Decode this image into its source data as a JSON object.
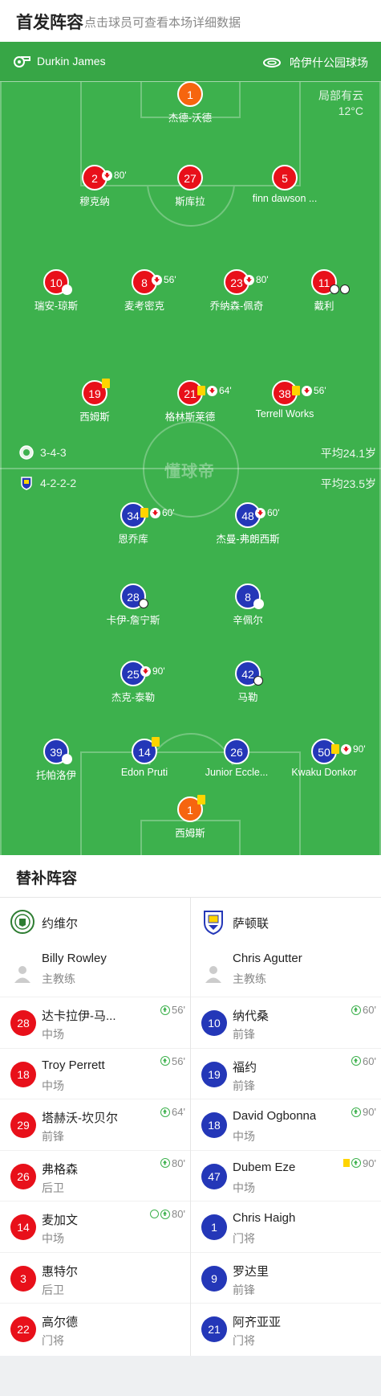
{
  "header": {
    "title": "首发阵容",
    "subtitle": "点击球员可查看本场详细数据"
  },
  "info": {
    "referee": "Durkin James",
    "venue": "哈伊什公园球场",
    "weather": "局部有云",
    "temperature": "12°C"
  },
  "home": {
    "formation": "3-4-3",
    "avg_age": "平均24.1岁",
    "players": [
      {
        "num": "1",
        "name": "杰德-沃德",
        "gk": true
      },
      {
        "num": "2",
        "name": "穆克纳",
        "sub_time": "80'"
      },
      {
        "num": "27",
        "name": "斯库拉"
      },
      {
        "num": "5",
        "name": "finn dawson ..."
      },
      {
        "num": "10",
        "name": "瑞安-琼斯"
      },
      {
        "num": "8",
        "name": "麦考密克",
        "sub_time": "56'"
      },
      {
        "num": "23",
        "name": "乔纳森-佩奇",
        "sub_time": "80'"
      },
      {
        "num": "11",
        "name": "戴利"
      },
      {
        "num": "19",
        "name": "西姆斯"
      },
      {
        "num": "21",
        "name": "格林斯莱德",
        "sub_time": "64'"
      },
      {
        "num": "38",
        "name": "Terrell Works",
        "sub_time": "56'"
      }
    ]
  },
  "away": {
    "formation": "4-2-2-2",
    "avg_age": "平均23.5岁",
    "players": [
      {
        "num": "34",
        "name": "恩乔库",
        "sub_time": "60'"
      },
      {
        "num": "48",
        "name": "杰曼-弗朗西斯",
        "sub_time": "60'"
      },
      {
        "num": "28",
        "name": "卡伊-詹宁斯"
      },
      {
        "num": "8",
        "name": "辛佩尔"
      },
      {
        "num": "25",
        "name": "杰克-泰勒",
        "sub_time": "90'"
      },
      {
        "num": "42",
        "name": "马勒"
      },
      {
        "num": "39",
        "name": "托帕洛伊"
      },
      {
        "num": "14",
        "name": "Edon Pruti"
      },
      {
        "num": "26",
        "name": "Junior Eccle..."
      },
      {
        "num": "50",
        "name": "Kwaku Donkor",
        "sub_time": "90'"
      },
      {
        "num": "1",
        "name": "西姆斯",
        "gk": true
      }
    ]
  },
  "watermark": "懂球帝",
  "subs": {
    "title": "替补阵容",
    "left": {
      "team": "约维尔",
      "coach": {
        "name": "Billy Rowley",
        "role": "主教练"
      },
      "players": [
        {
          "num": "28",
          "name": "达卡拉伊-马...",
          "pos": "中场",
          "time": "56'"
        },
        {
          "num": "18",
          "name": "Troy Perrett",
          "pos": "中场",
          "time": "56'"
        },
        {
          "num": "29",
          "name": "塔赫沃-坎贝尔",
          "pos": "前锋",
          "time": "64'"
        },
        {
          "num": "26",
          "name": "弗格森",
          "pos": "后卫",
          "time": "80'"
        },
        {
          "num": "14",
          "name": "麦加文",
          "pos": "中场",
          "time": "80'"
        },
        {
          "num": "3",
          "name": "惠特尔",
          "pos": "后卫",
          "time": ""
        },
        {
          "num": "22",
          "name": "高尔德",
          "pos": "门将",
          "time": ""
        }
      ]
    },
    "right": {
      "team": "萨顿联",
      "coach": {
        "name": "Chris Agutter",
        "role": "主教练"
      },
      "players": [
        {
          "num": "10",
          "name": "纳代桑",
          "pos": "前锋",
          "time": "60'"
        },
        {
          "num": "19",
          "name": "福约",
          "pos": "前锋",
          "time": "60'"
        },
        {
          "num": "18",
          "name": "David Ogbonna",
          "pos": "中场",
          "time": "90'"
        },
        {
          "num": "47",
          "name": "Dubem Eze",
          "pos": "中场",
          "time": "90'"
        },
        {
          "num": "1",
          "name": "Chris Haigh",
          "pos": "门将",
          "time": ""
        },
        {
          "num": "9",
          "name": "罗达里",
          "pos": "前锋",
          "time": ""
        },
        {
          "num": "21",
          "name": "阿齐亚亚",
          "pos": "门将",
          "time": ""
        }
      ]
    }
  }
}
